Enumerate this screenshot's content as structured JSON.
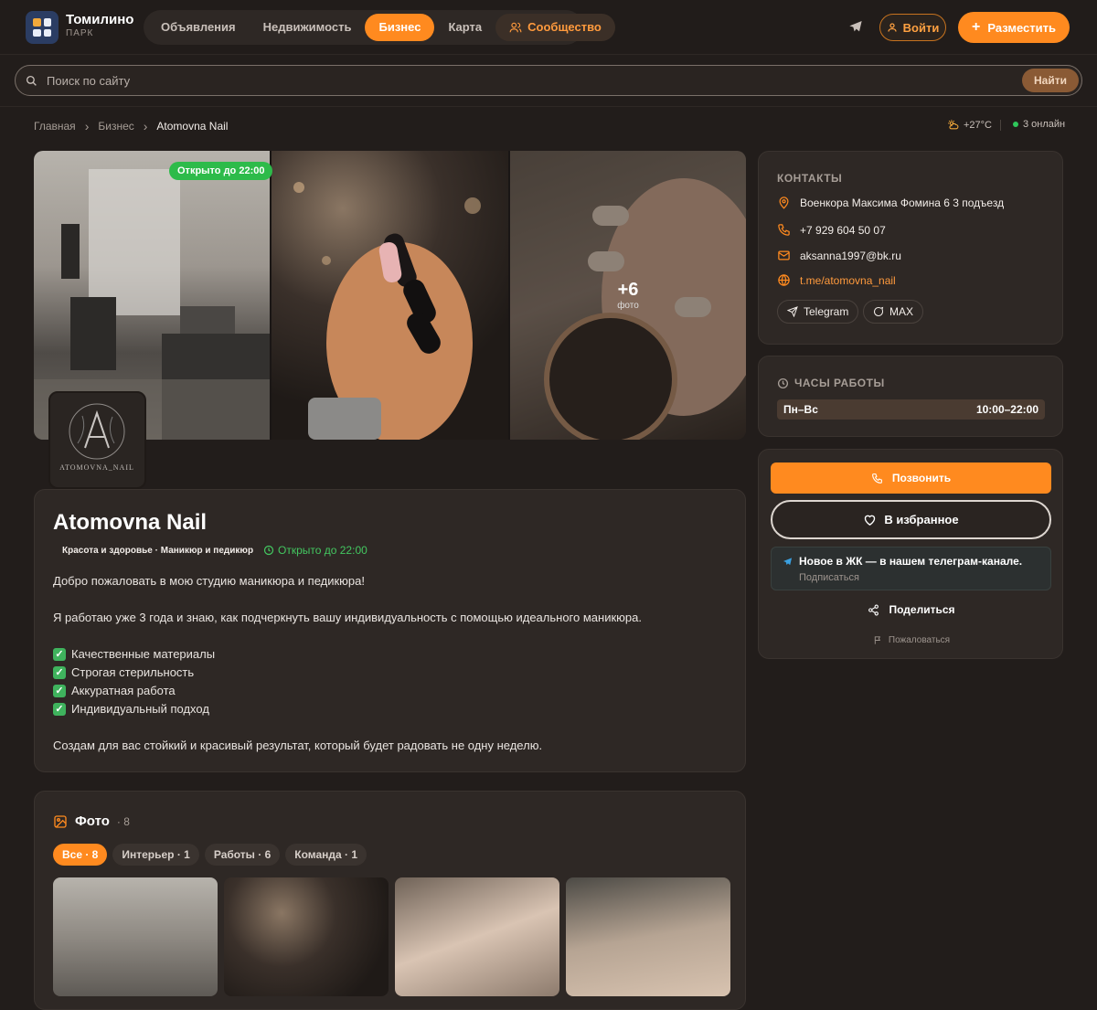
{
  "header": {
    "brand_name": "Томилино",
    "brand_sub": "ПАРК",
    "nav": [
      "Объявления",
      "Недвижимость",
      "Бизнес",
      "Карта",
      "Сообщество"
    ],
    "active_nav": "Бизнес",
    "login_label": "Войти",
    "post_label": "Разместить"
  },
  "search": {
    "placeholder": "Поиск по сайту",
    "button_label": "Найти"
  },
  "breadcrumb": [
    "Главная",
    "Бизнес",
    "Atomovna Nail"
  ],
  "status": {
    "temperature": "+27°C",
    "online": "3 онлайн"
  },
  "gallery": {
    "open_badge": "Открыто до 22:00",
    "more_count": "+6",
    "more_label": "фото"
  },
  "business": {
    "logo_text": "ATOMOVNA_NAIL",
    "title": "Atomovna Nail",
    "category": "Красота и здоровье · Маникюр и педикюр",
    "open_status": "Открыто до 22:00",
    "welcome": "Добро пожаловать в мою студию маникюра и педикюра!",
    "experience": "Я работаю уже 3 года и знаю, как подчеркнуть вашу индивидуальность с помощью идеального маникюра.",
    "features": [
      "Качественные материалы",
      "Строгая стерильность",
      "Аккуратная работа",
      "Индивидуальный подход"
    ],
    "closing": "Создам для вас стойкий и красивый результат, который будет радовать не одну неделю."
  },
  "photos": {
    "title": "Фото",
    "count": "· 8",
    "filters": [
      "Все · 8",
      "Интерьер · 1",
      "Работы · 6",
      "Команда · 1"
    ]
  },
  "contacts": {
    "title": "КОНТАКТЫ",
    "address": "Военкора Максима Фомина 6 3 подъезд",
    "phone": "+7 929 604 50 07",
    "email": "aksanna1997@bk.ru",
    "link": "t.me/atomovna_nail",
    "telegram_label": "Telegram",
    "max_label": "MAX"
  },
  "hours": {
    "title": "ЧАСЫ РАБОТЫ",
    "days": "Пн–Вс",
    "time": "10:00–22:00"
  },
  "actions": {
    "call_label": "Позвонить",
    "favorite_label": "В избранное",
    "promo_title": "Новое в ЖК — в нашем телеграм-канале.",
    "promo_sub": "Подписаться",
    "share_label": "Поделиться",
    "report_label": "Пожаловаться"
  },
  "colors": {
    "accent": "#ff8a1f",
    "background": "#221d1b",
    "card": "#2e2825",
    "open_green": "#2dbb4a"
  }
}
